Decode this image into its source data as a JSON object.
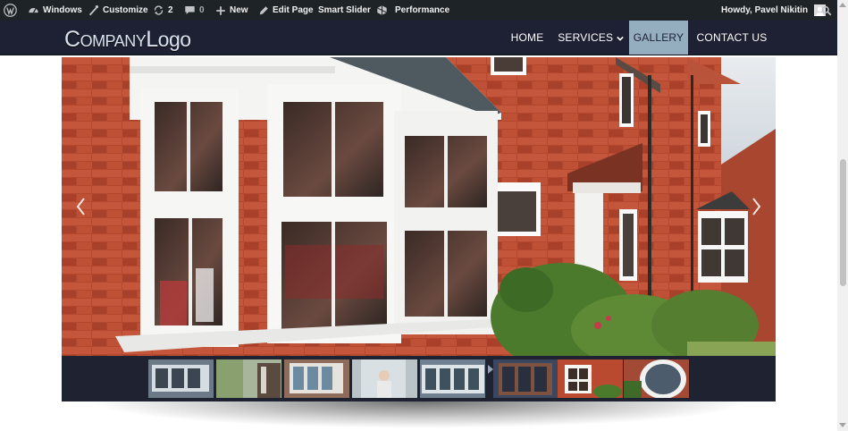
{
  "adminbar": {
    "site_name": "Windows",
    "customize": "Customize",
    "updates_count": "2",
    "comments_count": "0",
    "new_label": "New",
    "edit_page": "Edit Page",
    "smart_slider": "Smart Slider",
    "performance": "Performance",
    "howdy": "Howdy, Pavel Nikitin"
  },
  "header": {
    "logo_big_c": "C",
    "logo_ompany": "OMPANY",
    "logo_big_l": "L",
    "logo_ogo": "ogo",
    "nav": [
      {
        "label": "HOME"
      },
      {
        "label": "SERVICES"
      },
      {
        "label": "GALLERY"
      },
      {
        "label": "CONTACT US"
      }
    ]
  },
  "slider": {
    "slide_count": 8,
    "active_thumb": 7
  },
  "colors": {
    "adminbar_bg": "#1d2327",
    "header_bg": "#1e2033",
    "active_nav_bg": "#94aebf",
    "thumbbar_bg": "#1f2230",
    "brick": "#b34a32"
  }
}
